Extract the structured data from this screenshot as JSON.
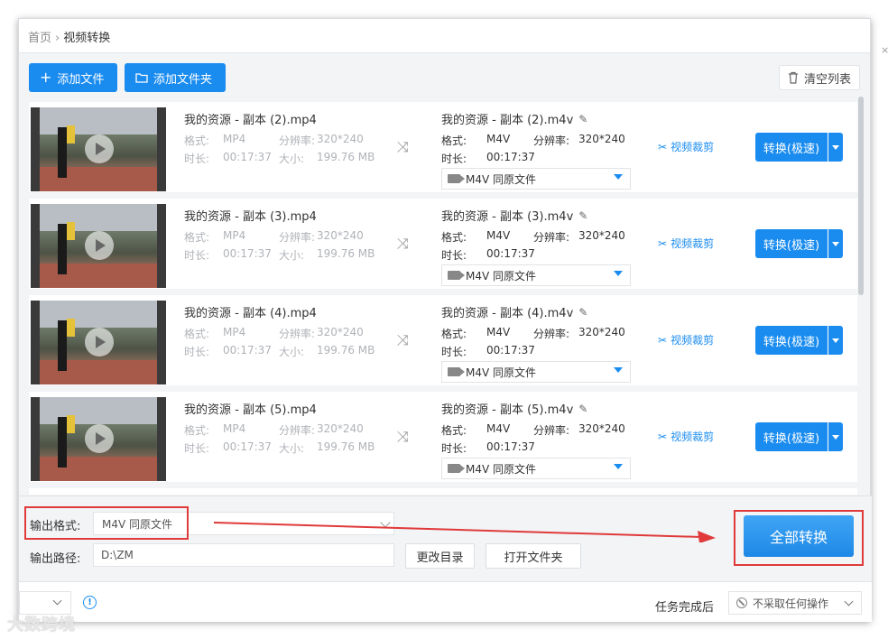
{
  "breadcrumb": {
    "home": "首页",
    "separator": "›",
    "current": "视频转换"
  },
  "toolbar": {
    "add_file_label": "添加文件",
    "add_folder_label": "添加文件夹",
    "clear_list_label": "清空列表"
  },
  "labels": {
    "format": "格式:",
    "resolution": "分辨率:",
    "duration": "时长:",
    "size": "大小:"
  },
  "items": [
    {
      "src_name": "我的资源 - 副本 (2).mp4",
      "src_format": "MP4",
      "resolution": "320*240",
      "duration": "00:17:37",
      "size": "199.76 MB",
      "out_name": "我的资源 - 副本 (2).m4v",
      "out_format": "M4V",
      "out_option": "M4V  同原文件",
      "crop_label": "视频裁剪",
      "convert_label": "转换(极速)"
    },
    {
      "src_name": "我的资源 - 副本 (3).mp4",
      "src_format": "MP4",
      "resolution": "320*240",
      "duration": "00:17:37",
      "size": "199.76 MB",
      "out_name": "我的资源 - 副本 (3).m4v",
      "out_format": "M4V",
      "out_option": "M4V  同原文件",
      "crop_label": "视频裁剪",
      "convert_label": "转换(极速)"
    },
    {
      "src_name": "我的资源 - 副本 (4).mp4",
      "src_format": "MP4",
      "resolution": "320*240",
      "duration": "00:17:37",
      "size": "199.76 MB",
      "out_name": "我的资源 - 副本 (4).m4v",
      "out_format": "M4V",
      "out_option": "M4V  同原文件",
      "crop_label": "视频裁剪",
      "convert_label": "转换(极速)"
    },
    {
      "src_name": "我的资源 - 副本 (5).mp4",
      "src_format": "MP4",
      "resolution": "320*240",
      "duration": "00:17:37",
      "size": "199.76 MB",
      "out_name": "我的资源 - 副本 (5).m4v",
      "out_format": "M4V",
      "out_option": "M4V  同原文件",
      "crop_label": "视频裁剪",
      "convert_label": "转换(极速)"
    }
  ],
  "bottom": {
    "output_format_label": "输出格式:",
    "output_format_value": "M4V  同原文件",
    "output_path_label": "输出路径:",
    "output_path_value": "D:\\ZM",
    "change_dir_label": "更改目录",
    "open_folder_label": "打开文件夹",
    "convert_all_label": "全部转换"
  },
  "status": {
    "after_task_label": "任务完成后",
    "after_task_value": "不采取任何操作"
  },
  "watermark": "大数跨境",
  "colors": {
    "accent": "#1a8cf0",
    "highlight": "#e03a3a"
  }
}
